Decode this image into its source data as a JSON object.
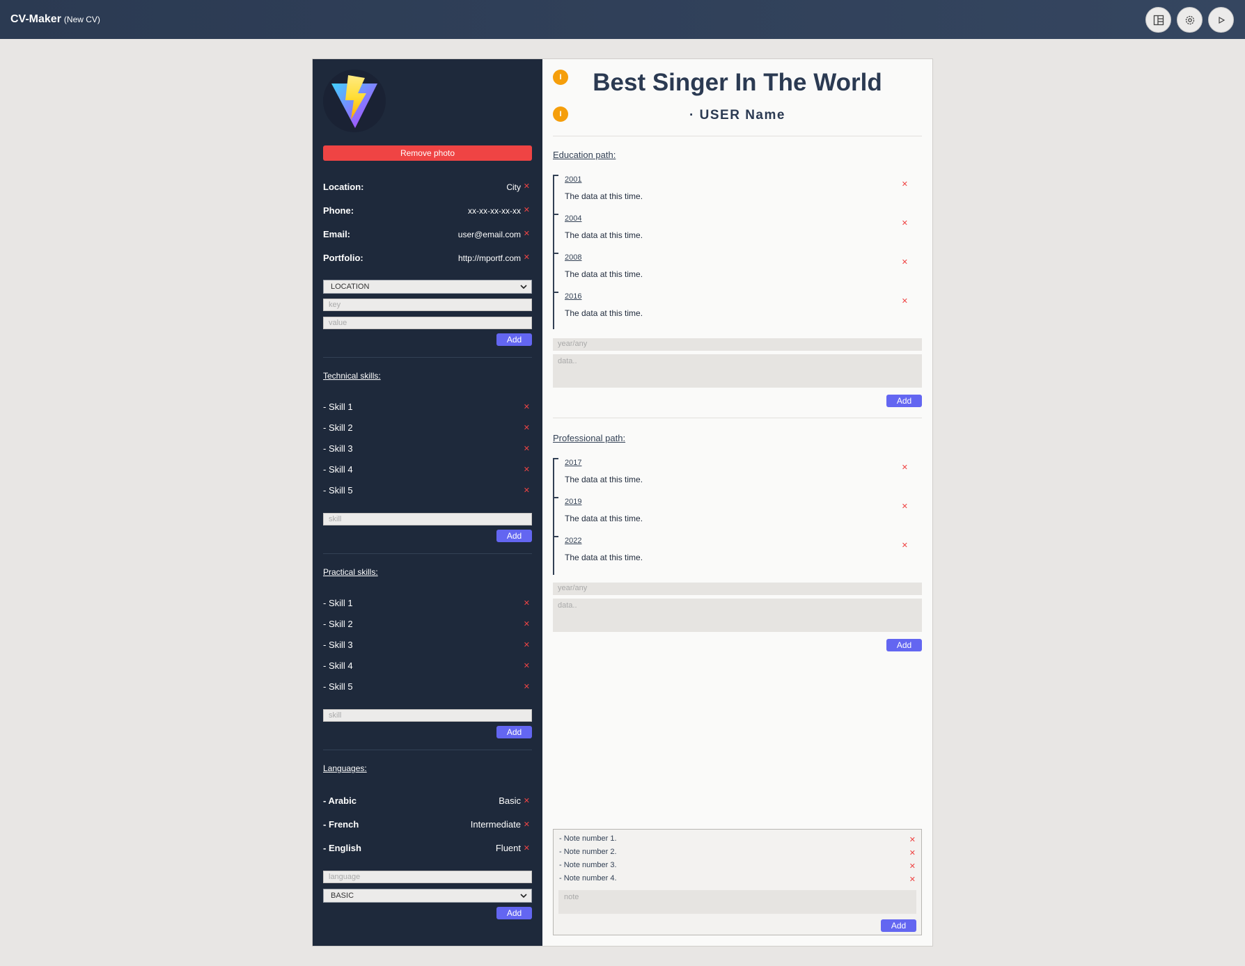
{
  "app": {
    "name": "CV-Maker",
    "subtitle": "(New CV)"
  },
  "toolbar": {
    "icons": [
      "layout-icon",
      "gear-icon",
      "play-icon"
    ]
  },
  "side": {
    "remove_photo": "Remove photo",
    "info": [
      {
        "key": "Location:",
        "value": "City"
      },
      {
        "key": "Phone:",
        "value": "xx-xx-xx-xx-xx"
      },
      {
        "key": "Email:",
        "value": "user@email.com"
      },
      {
        "key": "Portfolio:",
        "value": "http://mportf.com"
      }
    ],
    "info_select": "LOCATION",
    "key_placeholder": "key",
    "value_placeholder": "value",
    "add": "Add",
    "technical_title": "Technical skills:",
    "technical": [
      "- Skill 1",
      "- Skill 2",
      "- Skill 3",
      "- Skill 4",
      "- Skill 5"
    ],
    "skill_placeholder": "skill",
    "practical_title": "Practical skills:",
    "practical": [
      "- Skill 1",
      "- Skill 2",
      "- Skill 3",
      "- Skill 4",
      "- Skill 5"
    ],
    "languages_title": "Languages:",
    "languages": [
      {
        "name": "- Arabic",
        "level": "Basic"
      },
      {
        "name": "- French",
        "level": "Intermediate"
      },
      {
        "name": "- English",
        "level": "Fluent"
      }
    ],
    "language_placeholder": "language",
    "level_select": "BASIC"
  },
  "main": {
    "title": "Best Singer In The World",
    "username": "· USER Name",
    "dot_label": "I",
    "education_title": "Education path:",
    "education": [
      {
        "year": "2001",
        "text": "The data at this time."
      },
      {
        "year": "2004",
        "text": "The data at this time."
      },
      {
        "year": "2008",
        "text": "The data at this time."
      },
      {
        "year": "2016",
        "text": "The data at this time."
      }
    ],
    "professional_title": "Professional path:",
    "professional": [
      {
        "year": "2017",
        "text": "The data at this time."
      },
      {
        "year": "2019",
        "text": "The data at this time."
      },
      {
        "year": "2022",
        "text": "The data at this time."
      }
    ],
    "year_placeholder": "year/any",
    "data_placeholder": "data..",
    "add": "Add",
    "notes": [
      "- Note number 1.",
      "- Note number 2.",
      "- Note number 3.",
      "- Note number 4."
    ],
    "note_placeholder": "note"
  },
  "colors": {
    "accent": "#6366f1",
    "danger": "#ef4444",
    "dot": "#f59e0b",
    "sidebar": "#1e293b",
    "topbar": "#2b3a52"
  }
}
